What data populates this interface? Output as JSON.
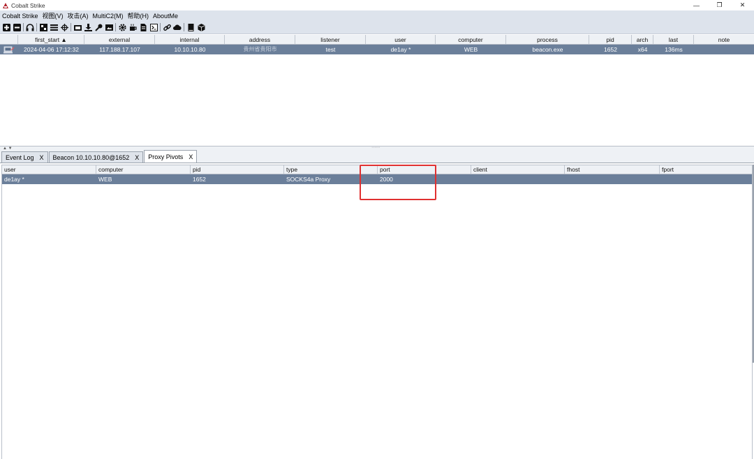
{
  "window": {
    "title": "Cobalt Strike",
    "controls": [
      "—",
      "❐",
      "✕"
    ]
  },
  "menu": [
    "Cobalt Strike",
    "视图(V)",
    "攻击(A)",
    "MultiC2(M)",
    "帮助(H)",
    "AboutMe"
  ],
  "toolbar": {
    "icons": [
      "plus-icon",
      "minus-icon",
      "headphones-icon",
      "graph-icon",
      "list-icon",
      "crosshair-icon",
      "screenshot-icon",
      "download-icon",
      "key-icon",
      "image-icon",
      "gear-icon",
      "coffee-icon",
      "file-icon",
      "terminal-icon",
      "link-icon",
      "cloud-icon",
      "book-icon",
      "cube-icon"
    ]
  },
  "beacons": {
    "columns": [
      "",
      "first_start ▲",
      "external",
      "internal",
      "address",
      "listener",
      "user",
      "computer",
      "process",
      "pid",
      "arch",
      "last",
      "note"
    ],
    "rows": [
      {
        "first_start": "2024-04-06 17:12:32",
        "external": "117.188.17.107",
        "internal": "10.10.10.80",
        "address": "贵州省贵阳市",
        "listener": "test",
        "user": "de1ay *",
        "computer": "WEB",
        "process": "beacon.exe",
        "pid": "1652",
        "arch": "x64",
        "last": "136ms",
        "note": ""
      }
    ]
  },
  "tabs": [
    {
      "label": "Event Log",
      "close": "X",
      "active": false
    },
    {
      "label": "Beacon 10.10.10.80@1652",
      "close": "X",
      "active": false
    },
    {
      "label": "Proxy Pivots",
      "close": "X",
      "active": true
    }
  ],
  "pivots": {
    "columns": [
      "user",
      "computer",
      "pid",
      "type",
      "port",
      "client",
      "fhost",
      "fport"
    ],
    "rows": [
      {
        "user": "de1ay *",
        "computer": "WEB",
        "pid": "1652",
        "type": "SOCKS4a Proxy",
        "port": "2000",
        "client": "",
        "fhost": "",
        "fport": ""
      }
    ]
  },
  "colors": {
    "selected_row": "#6b7f9a",
    "highlight": "#e03030",
    "menubar": "#dde3ec"
  }
}
